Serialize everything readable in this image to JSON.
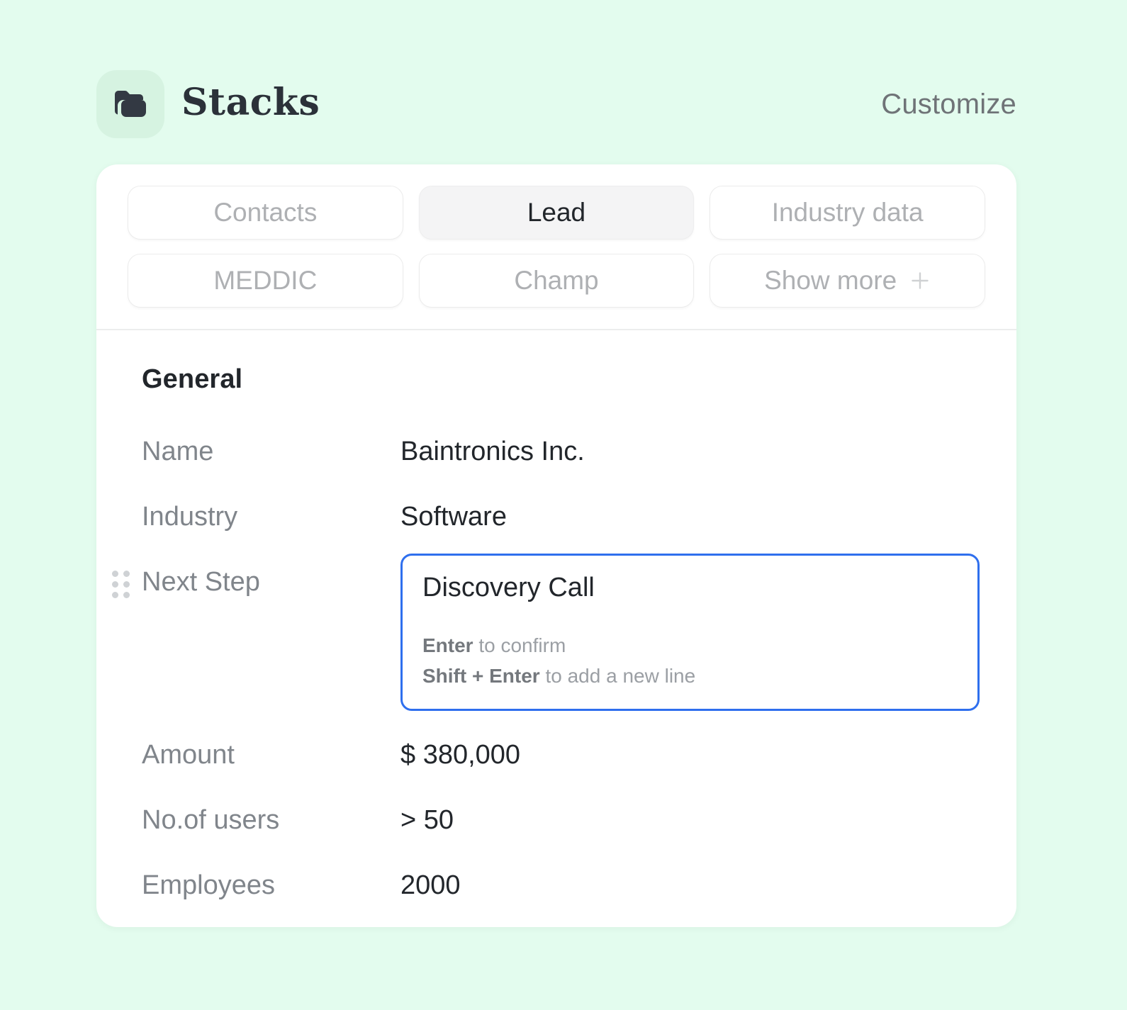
{
  "header": {
    "brand_title": "Stacks",
    "logo_icon": "stacked-folders-icon",
    "customize_label": "Customize"
  },
  "tabs": [
    {
      "label": "Contacts",
      "active": false
    },
    {
      "label": "Lead",
      "active": true
    },
    {
      "label": "Industry data",
      "active": false
    },
    {
      "label": "MEDDIC",
      "active": false
    },
    {
      "label": "Champ",
      "active": false
    },
    {
      "label": "Show more",
      "active": false,
      "icon": "plus-icon"
    }
  ],
  "section": {
    "title": "General"
  },
  "fields": [
    {
      "label": "Name",
      "value": "Baintronics Inc."
    },
    {
      "label": "Industry",
      "value": "Software"
    },
    {
      "label": "Next Step",
      "value": "Discovery Call",
      "editing": true,
      "handle": "drag-handle-icon"
    },
    {
      "label": "Amount",
      "value": "$ 380,000"
    },
    {
      "label": "No.of users",
      "value": "> 50"
    },
    {
      "label": "Employees",
      "value": "2000"
    }
  ],
  "editor": {
    "value": "Discovery Call",
    "hint_line1_strong": "Enter",
    "hint_line1_rest": " to confirm",
    "hint_line2_strong": "Shift + Enter",
    "hint_line2_rest": " to add a new line"
  },
  "colors": {
    "page_background": "#e3fcee",
    "card_background": "#ffffff",
    "accent_blue": "#2f6fee",
    "active_tab_background": "#f4f4f5",
    "logo_background": "#d6f3e1",
    "text_dark": "#22262b",
    "text_muted": "#80858b",
    "text_placeholder": "#aeb0b3"
  }
}
